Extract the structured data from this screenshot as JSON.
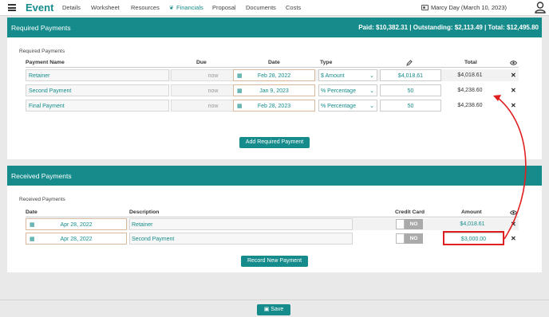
{
  "nav": {
    "brand": "Event",
    "items": [
      "Details",
      "Worksheet",
      "Resources",
      "Financials",
      "Proposal",
      "Documents",
      "Costs"
    ],
    "active": "Financials",
    "user": "Marcy Day (March 10, 2023)"
  },
  "required": {
    "header_title": "Required Payments",
    "summary": "Paid: $10,382.31  |  Outstanding: $2,113.49  |  Total: $12,495.80",
    "sub_title": "Required Payments",
    "columns": {
      "name": "Payment Name",
      "due": "Due",
      "date": "Date",
      "type": "Type",
      "total": "Total"
    },
    "rows": [
      {
        "name": "Retainer",
        "due": "now",
        "date": "Feb 28, 2022",
        "type": "$ Amount",
        "amount": "$4,018.61",
        "total": "$4,018.61"
      },
      {
        "name": "Second Payment",
        "due": "now",
        "date": "Jan 9, 2023",
        "type": "% Percentage",
        "amount": "50",
        "total": "$4,238.60"
      },
      {
        "name": "Final Payment",
        "due": "now",
        "date": "Feb 28, 2023",
        "type": "% Percentage",
        "amount": "50",
        "total": "$4,238.60"
      }
    ],
    "add_button": "Add Required Payment"
  },
  "received": {
    "header_title": "Received Payments",
    "sub_title": "Received Payments",
    "columns": {
      "date": "Date",
      "description": "Description",
      "credit_card": "Credit Card",
      "amount": "Amount"
    },
    "rows": [
      {
        "date": "Apr 28, 2022",
        "description": "Retainer",
        "credit_card": "NO",
        "amount": "$4,018.61"
      },
      {
        "date": "Apr 28, 2022",
        "description": "Second Payment",
        "credit_card": "NO",
        "amount": "$3,000.00"
      }
    ],
    "record_button": "Record New Payment"
  },
  "footer": {
    "save_label": "Save"
  },
  "colors": {
    "accent": "#168b8b",
    "annotation": "#e02020"
  },
  "icons": {
    "menu": "hamburger-icon",
    "calendar": "calendar-icon",
    "delete": "close-icon",
    "visibility": "eye-icon",
    "edit": "pencil-icon",
    "save": "save-icon",
    "user": "avatar-icon",
    "user_card": "id-card-icon"
  }
}
